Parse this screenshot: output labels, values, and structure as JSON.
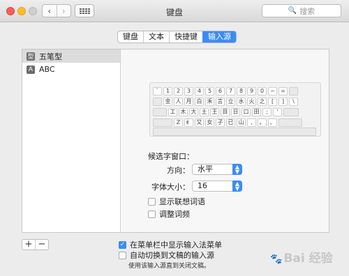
{
  "window": {
    "title": "键盘"
  },
  "toolbar": {
    "back": "‹",
    "forward": "›"
  },
  "search": {
    "placeholder": "搜索"
  },
  "tabs": [
    {
      "label": "键盘",
      "active": false
    },
    {
      "label": "文本",
      "active": false
    },
    {
      "label": "快捷键",
      "active": false
    },
    {
      "label": "输入源",
      "active": true
    }
  ],
  "sources": [
    {
      "icon": "型",
      "label": "五笔型",
      "selected": true
    },
    {
      "icon": "A",
      "label": "ABC",
      "selected": false
    }
  ],
  "keyboard_rows": [
    [
      "`",
      "1",
      "2",
      "3",
      "4",
      "5",
      "6",
      "7",
      "8",
      "9",
      "0",
      "−",
      "="
    ],
    [
      "金",
      "人",
      "月",
      "白",
      "禾",
      "言",
      "立",
      "水",
      "火",
      "之",
      "[",
      "]",
      "\\"
    ],
    [
      "工",
      "木",
      "大",
      "土",
      "王",
      "目",
      "日",
      "口",
      "田",
      ";",
      "'"
    ],
    [
      "Z",
      "纟",
      "又",
      "女",
      "子",
      "已",
      "山",
      ",",
      "。",
      "、"
    ]
  ],
  "candidate": {
    "group_label": "候选字窗口：",
    "direction_label": "方向：",
    "direction_value": "水平",
    "fontsize_label": "字体大小：",
    "fontsize_value": "16"
  },
  "options": {
    "show_association": {
      "label": "显示联想词语",
      "checked": false
    },
    "adjust_frequency": {
      "label": "调整词频",
      "checked": false
    },
    "show_in_menubar": {
      "label": "在菜单栏中显示输入法菜单",
      "checked": true
    },
    "auto_switch": {
      "label": "自动切换到文稿的输入源",
      "checked": false
    }
  },
  "note": "使用该输入源直到关闭文稿。",
  "buttons": {
    "add": "+",
    "remove": "−"
  },
  "watermark": "Bai 经验",
  "colors": {
    "accent": "#3b8cf7"
  }
}
